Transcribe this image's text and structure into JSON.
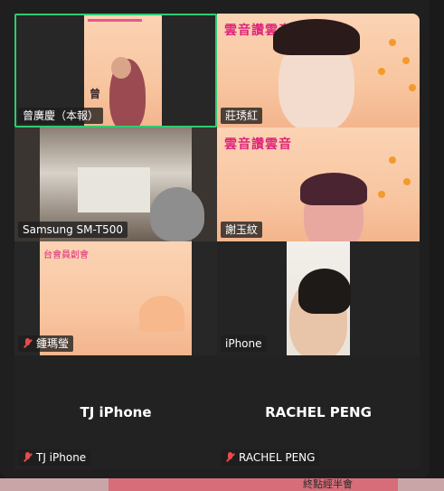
{
  "participants": [
    {
      "name": "曾廣慶（本報）",
      "muted": false,
      "active_speaker": true
    },
    {
      "name": "莊琇紅",
      "muted": false
    },
    {
      "name": "Samsung SM-T500",
      "muted": false
    },
    {
      "name": "謝玉紋",
      "muted": false
    },
    {
      "name": "鍾瑪瑩",
      "muted": true
    },
    {
      "name": "iPhone",
      "muted": false
    },
    {
      "name": "TJ iPhone",
      "muted": true,
      "video_off": true
    },
    {
      "name": "RACHEL PENG",
      "muted": true,
      "video_off": true
    }
  ],
  "slide_titles": {
    "title_a": "雲音讚雲音",
    "title_b": "雲音讚雲音",
    "tile5_text": "台會員創會",
    "tile1_text": "曾"
  },
  "colors": {
    "active_border": "#2ecc71",
    "muted_mic": "#e74c4c",
    "slide_bg": "#f8c6a1",
    "slide_title": "#e0247a"
  },
  "background_text": "終點經半會"
}
